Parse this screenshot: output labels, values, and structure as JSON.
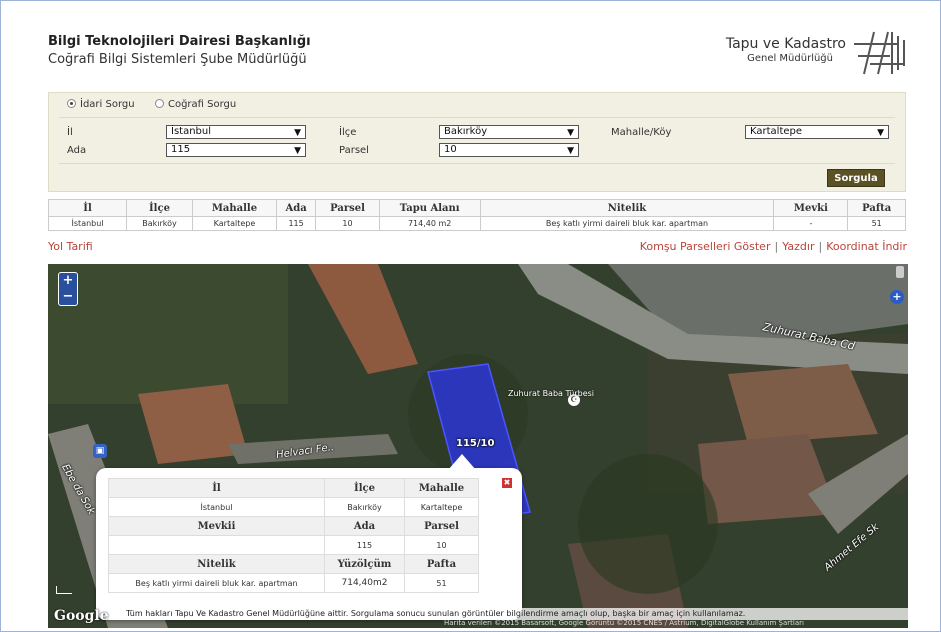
{
  "header": {
    "title": "Bilgi Teknolojileri Dairesi Başkanlığı",
    "subtitle": "Coğrafi Bilgi Sistemleri Şube Müdürlüğü",
    "org_name": "Tapu ve Kadastro",
    "org_sub": "Genel Müdürlüğü"
  },
  "query": {
    "mode_idari": "İdari Sorgu",
    "mode_cografi": "Coğrafi Sorgu",
    "il_label": "İl",
    "il_value": "İstanbul",
    "ilce_label": "İlçe",
    "ilce_value": "Bakırköy",
    "mahalle_label": "Mahalle/Köy",
    "mahalle_value": "Kartaltepe",
    "ada_label": "Ada",
    "ada_value": "115",
    "parsel_label": "Parsel",
    "parsel_value": "10",
    "submit_label": "Sorgula"
  },
  "results": {
    "headers": [
      "İl",
      "İlçe",
      "Mahalle",
      "Ada",
      "Parsel",
      "Tapu Alanı",
      "Nitelik",
      "Mevki",
      "Pafta"
    ],
    "row": [
      "İstanbul",
      "Bakırköy",
      "Kartaltepe",
      "115",
      "10",
      "714,40 m2",
      "Beş katlı yirmi daireli bluk kar. apartman",
      "-",
      "51"
    ]
  },
  "links": {
    "yol_tarifi": "Yol Tarifi",
    "komsu": "Komşu Parselleri Göster",
    "yazdir": "Yazdır",
    "koordinat": "Koordinat İndir",
    "separator": "|"
  },
  "map": {
    "street1": "Zuhurat Baba Cd",
    "street2": "Helvacı Fe..",
    "street3": "Ahmet Efe Sk",
    "street4": "Ebe da Sok",
    "poi": "Zuhurat Baba Türbesi",
    "parcel_label": "115/10",
    "google": "Google",
    "copyright": "Tüm hakları Tapu Ve Kadastro Genel Müdürlüğüne aittir. Sorgulama sonucu sunulan görüntüler bilgilendirme amaçlı olup, başka bir amaç için kullanılamaz.",
    "credits": "Harita verileri ©2015 Basarsoft, Google Görüntü ©2015 CNES / Astrium, DigitalGlobe    Kullanım Şartları",
    "zoom_in": "+",
    "zoom_out": "−"
  },
  "popup": {
    "h_il": "İl",
    "h_ilce": "İlçe",
    "h_mahalle": "Mahalle",
    "v_il": "İstanbul",
    "v_ilce": "Bakırköy",
    "v_mahalle": "Kartaltepe",
    "h_mevkii": "Mevkii",
    "h_ada": "Ada",
    "h_parsel": "Parsel",
    "v_mevkii": "",
    "v_ada": "115",
    "v_parsel": "10",
    "h_nitelik": "Nitelik",
    "h_yuzolcum": "Yüzölçüm",
    "h_pafta": "Pafta",
    "v_nitelik": "Beş katlı yirmi daireli bluk kar. apartman",
    "v_yuzolcum": "714,40m2",
    "v_pafta": "51",
    "close": "✖"
  },
  "colors": {
    "accent": "#b9443b",
    "button": "#5a5124",
    "parcel": "#2a35e0"
  }
}
